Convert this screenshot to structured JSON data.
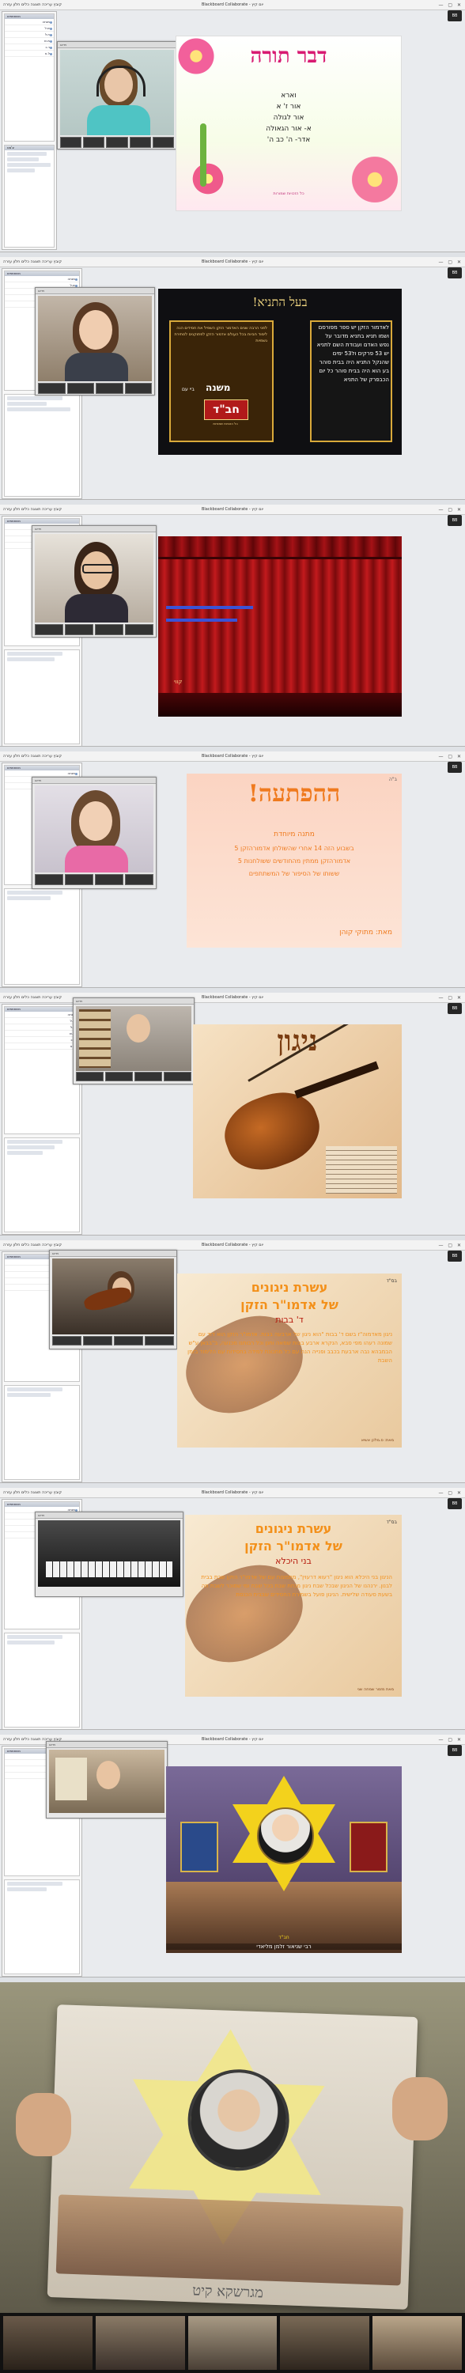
{
  "app": {
    "window_title": "Blackboard Collaborate - יום קיץ",
    "window_title_short": "Blackboard Collaborate - יום קיץ",
    "menu": "קובץ עריכה תצוגה כלים חלון עזרה",
    "window_controls": "— ▢ ✕",
    "toolbar_badge": "BB"
  },
  "sidebar": {
    "participants_title": "משתתפים",
    "participant_rows": [
      "מנחה",
      "ש.ל",
      "ח.ל",
      "מ.ש",
      "ר.כ",
      "ל.א",
      "פ.ק",
      "ב.ז"
    ],
    "chat_title": "צ'אט",
    "video_title": "וידאו"
  },
  "slides": {
    "s1": {
      "title": "דבר תורה",
      "lines": [
        "וארא",
        "אור ז' א",
        "אור לגולה",
        "א- אור הגאולה",
        "אדר- ה' כב ה'"
      ],
      "footer": "כל הזכויות שמורות"
    },
    "s2": {
      "title": "בעל התניא!",
      "right_text": "לאדמור הזקן יש ספר מפורסם ושמו תניא בתניא מדובר על נפש האדם ועבודת השם לתניא יש 53 פרקים ול53 ימים שהנקל התניא היה בבית סוהר בע הוא היה בבית סוהר כל יום הכבפרק של התניא",
      "left_text": "לפני הרבה שנים האדמור הזקן השפיל את חסידים הנה לימוד חביות בכל העולם אדמור הזקן לפתוקנים לסתירת גשמיות",
      "mishna_label": "משנה",
      "mishna_pre": "ביי עם",
      "logo": "חב\"ד",
      "logo_sub": "כל הזכויות שמורות"
    },
    "s3": {
      "caption": "קווי"
    },
    "s4": {
      "corner": "ב\"ה",
      "title": "ההפתעה!",
      "lines": [
        "מתנה מיוחדת",
        "בשבוע הזה 14 אחרי שהשולחן אדמורהזקן 5",
        "אדמורהזקן ממתין מהחודשים ששולחנות 5",
        "ששותו של הסיפור של המשתתפים"
      ],
      "signature": "מאת: מתוקי קוהן"
    },
    "s5": {
      "title": "ניגון"
    },
    "s6": {
      "corner": "בס\"ד",
      "title_1": "עשרת ניגונים",
      "title_2": "של אדמו\"ר הזקן",
      "title_3": "ד' בבות",
      "body": "ניגון מאדמוה\"ז בשם ד' בבות \"הוא ניגון של ארבעה בבות. אדמו\"ר הזקן הוא דוד עם שמונה רעהו מפי סבא, הנקרא ארבע בבות שמאה וחנן וכל רבותנו מכנעה, ב\"בבאן ע\"ש הבמבהא נבה ארבעת בכבב ופנייה הנה עם כל מתכונת למידה בחסידות עם הלימוד בזמן השבת",
      "footer": "מאת: ס.מלכן אשיא"
    },
    "s7": {
      "corner": "בס\"ד",
      "title_1": "עשרת ניגונים",
      "title_2": "של אדמו\"ר הזקן",
      "title_3": "בני היכלא",
      "body": "הניגון בני היכלא הוא ניגון \"רעוא דרעוין\", מתמצות עם של אדמו\"ר הזקן שבת בבית לבנון. ירנהנו של הניגון שבכל שבח ניגון מנחת שבת בכל שבת ומי שמוכר לשבת וזה בשעת סעודה שלישית. הניגון פועל בשמירת החסידים שבבית הכנסת",
      "footer": "מאת מזמר שמחה שני"
    },
    "s8": {
      "banner": "רבי שניאור זלמן מליאדי",
      "sub": "חב\"ד"
    },
    "photo": {
      "caption": "מגרשקא קיט"
    }
  },
  "colors": {
    "bb_blue": "#3b5e93",
    "slide1_title": "#d81b72",
    "slide2_gold": "#d9a93a",
    "curtain_red": "#9c0f12",
    "slide4_orange": "#ef7a1e",
    "violin_brown": "#7a3d12",
    "nigun_orange": "#f3901a",
    "star_yellow": "#f3d21c"
  },
  "icons": [
    "close-icon",
    "minimize-icon",
    "maximize-icon",
    "mic-icon",
    "camera-icon",
    "hand-icon"
  ]
}
